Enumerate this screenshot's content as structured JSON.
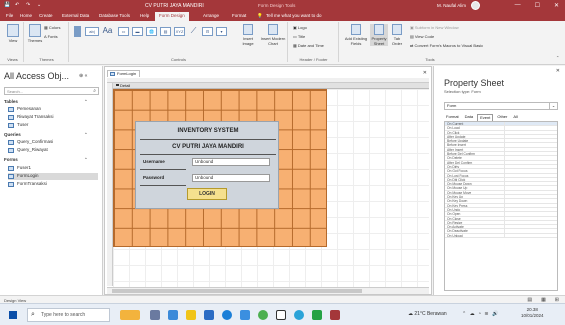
{
  "titlebar": {
    "title": "CV PUTRI JAYA MANDIRI",
    "context": "Form Design Tools",
    "search_hint": "Tell me what you want to do",
    "user": "M. Naufal Alim",
    "minimize": "—",
    "maximize": "☐",
    "close": "✕"
  },
  "tabs": [
    "File",
    "Home",
    "Create",
    "External Data",
    "Database Tools",
    "Help",
    "Form Design",
    "Arrange",
    "Format"
  ],
  "ribbon": {
    "views": {
      "label": "Views",
      "view": "View"
    },
    "themes": {
      "label": "Themes",
      "themes": "Themes",
      "colors": "Colors",
      "fonts": "Fonts"
    },
    "controls": {
      "label": "Controls",
      "insert_image": "Insert Image",
      "insert_modern_chart": "Insert Modern Chart"
    },
    "header_footer": {
      "label": "Header / Footer",
      "logo": "Logo",
      "title": "Title",
      "date_time": "Date and Time"
    },
    "tools": {
      "label": "Tools",
      "add_existing_fields": "Add Existing Fields",
      "property_sheet": "Property Sheet",
      "tab_order": "Tab Order",
      "subform": "Subform in New Window",
      "view_code": "View Code",
      "convert": "Convert Form's Macros to Visual Basic"
    }
  },
  "nav": {
    "title": "All Access Obj...",
    "search_placeholder": "Search...",
    "sections": [
      {
        "name": "Tables",
        "items": [
          "Pemesanan",
          "Riwayat Transaksi",
          "Tuser"
        ]
      },
      {
        "name": "Queries",
        "items": [
          "Query_Confirmasi",
          "Query_Riwayat"
        ]
      },
      {
        "name": "Forms",
        "items": [
          "Fuser1",
          "FormLogin",
          "FormTransaksi"
        ]
      }
    ],
    "selected_item": "FormLogin"
  },
  "document": {
    "tab": "FormLogin",
    "section": "Detail",
    "ruler_numbers": [
      "1",
      "2",
      "3",
      "4",
      "5",
      "6",
      "7",
      "8",
      "9",
      "10",
      "11",
      "12",
      "13"
    ]
  },
  "form": {
    "title1": "INVENTORY SYSTEM",
    "title2": "CV PUTRI JAYA MANDIRI",
    "username_label": "Username",
    "username_value": "Unbound",
    "password_label": "Password",
    "password_value": "Unbound",
    "login_button": "LOGIN"
  },
  "property_sheet": {
    "title": "Property Sheet",
    "selection_type": "Selection type: Form",
    "selected_object": "Form",
    "tabs": [
      "Format",
      "Data",
      "Event",
      "Other",
      "All"
    ],
    "active_tab": "Event",
    "events": [
      "On Current",
      "On Load",
      "On Click",
      "After Update",
      "Before Update",
      "Before Insert",
      "After Insert",
      "Before Del Confirm",
      "On Delete",
      "After Del Confirm",
      "On Dirty",
      "On Got Focus",
      "On Lost Focus",
      "On Dbl Click",
      "On Mouse Down",
      "On Mouse Up",
      "On Mouse Move",
      "On Key Up",
      "On Key Down",
      "On Key Press",
      "On Undo",
      "On Open",
      "On Close",
      "On Resize",
      "On Activate",
      "On Deactivate",
      "On Unload"
    ]
  },
  "statusbar": {
    "text": "Design View"
  },
  "taskbar": {
    "search_placeholder": "Type here to search",
    "weather": "21°C  Berawan",
    "time": "20.38",
    "date": "10/01/2024"
  }
}
